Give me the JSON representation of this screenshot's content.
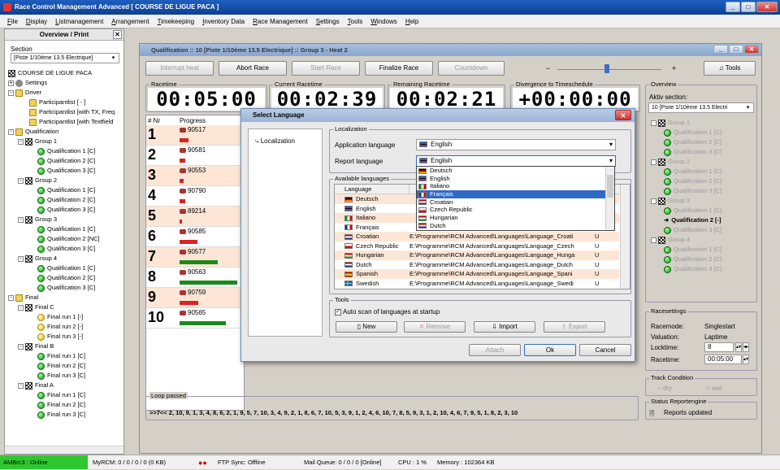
{
  "app": {
    "title": "Race Control Management Advanced  [ COURSE DE LIGUE PACA ]"
  },
  "menu": [
    "File",
    "Display",
    "Listmanagement",
    "Arrangement",
    "Timekeeping",
    "Inventory Data",
    "Race Management",
    "Settings",
    "Tools",
    "Windows",
    "Help"
  ],
  "left": {
    "title": "Overview / Print",
    "section_label": "Section",
    "section_value": "[Piste 1/10ème 13.5 Electrique]",
    "tree": [
      "COURSE DE LIGUE PACA",
      "Settings",
      "Driver",
      "Participantlist  [ - ]",
      "Participantlist [with TX, Freq",
      "Participantlist [with Textfield",
      "Qualification",
      "Group 1",
      "Qualification 1  [C]",
      "Qualification 2  [C]",
      "Qualification 3  [C]",
      "Group 2",
      "Qualification 1  [C]",
      "Qualification 2  [C]",
      "Qualification 3  [C]",
      "Group 3",
      "Qualification 1  [C]",
      "Qualification 2  [NC]",
      "Qualification 3  [C]",
      "Group 4",
      "Qualification 1  [C]",
      "Qualification 2  [C]",
      "Qualification 3  [C]",
      "Final",
      "Final C",
      "Final run 1  [-]",
      "Final run 2  [-]",
      "Final run 3  [-]",
      "Final B",
      "Final run 1  [C]",
      "Final run 2  [C]",
      "Final run 3  [C]",
      "Final A",
      "Final run 1  [C]",
      "Final run 2  [C]",
      "Final run 3  [C]"
    ]
  },
  "main": {
    "title": "Qualification :: 10  [Piste 1/10ème 13.5 Electrique] :: Group 3 - Heat 2",
    "buttons": {
      "interrupt": "Interrupt heat",
      "abort": "Abort Race",
      "start": "Start Race",
      "finalize": "Finalize Race",
      "countdown": "Countdown",
      "tools": "Tools"
    },
    "timers": {
      "racetime_label": "Racetime",
      "racetime": "00:05:00",
      "current_label": "Current Racetime",
      "current": "00:02:39",
      "remaining_label": "Remaining Racetime",
      "remaining": "00:02:21",
      "divergence_label": "Divergence to Timeschedule",
      "divergence": "+00:00:00"
    },
    "table": {
      "col_nr": "# Nr",
      "col_progress": "Progress",
      "rows": [
        {
          "n": "1",
          "id": "90517",
          "progress": 0.14,
          "color": "red"
        },
        {
          "n": "2",
          "id": "90581",
          "progress": 0.09,
          "color": "red"
        },
        {
          "n": "3",
          "id": "90553",
          "progress": 0.07,
          "color": "red"
        },
        {
          "n": "4",
          "id": "90790",
          "progress": 0.09,
          "color": "red"
        },
        {
          "n": "5",
          "id": "89214",
          "progress": 0.04,
          "color": "red"
        },
        {
          "n": "6",
          "id": "90585",
          "progress": 0.29,
          "color": "red"
        },
        {
          "n": "7",
          "id": "90577",
          "progress": 0.63,
          "color": "green"
        },
        {
          "n": "8",
          "id": "90563",
          "progress": 0.94,
          "color": "green"
        },
        {
          "n": "9",
          "id": "90759",
          "progress": 0.31,
          "color": "red"
        },
        {
          "n": "10",
          "id": "90565",
          "progress": 0.76,
          "color": "green"
        }
      ]
    },
    "loop": {
      "label": "Loop passed",
      "text": ">>7<< 2, 10, 9, 1, 3, 4, 8, 6, 2, 1, 9, 5, 7, 10, 3, 4, 9, 2, 1, 8, 6, 7, 10, 5, 3, 9, 1, 2, 4, 6, 10, 7, 8, 5, 9, 3, 1, 2, 10, 4, 6, 7, 9, 5, 1, 8, 2, 3, 10"
    }
  },
  "overview": {
    "title": "Overview",
    "aktiv_label": "Aktiv section:",
    "aktiv_value": "10  [Piste 1/10ème 13.5 Electri",
    "tree": [
      "Group 1",
      "Qualification 1  [C]",
      "Qualification 2  [C]",
      "Qualification 3  [C]",
      "Group 2",
      "Qualification 1  [C]",
      "Qualification 2  [C]",
      "Qualification 3  [C]",
      "Group 3",
      "Qualification 1  [C]",
      "Qualification 2  [-]",
      "Qualification 3  [C]",
      "Group 4",
      "Qualification 1  [C]",
      "Qualification 2  [C]",
      "Qualification 3  [C]"
    ]
  },
  "racesettings": {
    "title": "Racesettings",
    "racemode_label": "Racemode:",
    "racemode": "Singlestart",
    "valuation_label": "Valuation:",
    "valuation": "Laptime",
    "locktime_label": "Locktime:",
    "locktime": "8",
    "racetime_label": "Racetime:",
    "racetime": "00:05:00"
  },
  "track": {
    "title": "Track Condition",
    "dry": "dry",
    "wet": "wet"
  },
  "reportengine": {
    "title": "Status Reportengine",
    "status": "Reports updated"
  },
  "dialog": {
    "title": "Select Language",
    "nav": "Localization",
    "localization_group": "Localization",
    "app_lang_label": "Application language",
    "app_lang": "English",
    "report_lang_label": "Report language",
    "report_lang": "English",
    "dropdown": [
      "Deutsch",
      "English",
      "Italiano",
      "Français",
      "Croatian",
      "Czech Republic",
      "Hungarian",
      "Dutch"
    ],
    "available_label": "Available languages",
    "lv_col1": "Language",
    "languages": [
      {
        "name": "Deutsch",
        "path": "",
        "u": ""
      },
      {
        "name": "English",
        "path": "",
        "u": ""
      },
      {
        "name": "Italiano",
        "path": "",
        "u": ""
      },
      {
        "name": "Français",
        "path": "",
        "u": ""
      },
      {
        "name": "Croatian",
        "path": "E:\\Programme\\RCM Advanced\\Languages\\Language_Croati",
        "u": "U"
      },
      {
        "name": "Czech Republic",
        "path": "E:\\Programme\\RCM Advanced\\Languages\\Language_Czech",
        "u": "U"
      },
      {
        "name": "Hungarian",
        "path": "E:\\Programme\\RCM Advanced\\Languages\\Language_Hunga",
        "u": "U"
      },
      {
        "name": "Dutch",
        "path": "E:\\Programme\\RCM Advanced\\Languages\\Language_Dutch",
        "u": "U"
      },
      {
        "name": "Spanish",
        "path": "E:\\Programme\\RCM Advanced\\Languages\\Language_Spani",
        "u": "U"
      },
      {
        "name": "Swedish",
        "path": "E:\\Programme\\RCM Advanced\\Languages\\Language_Swedi",
        "u": "U"
      }
    ],
    "tools_label": "Tools",
    "autoscan": "Auto scan of languages at startup",
    "new": "New",
    "remove": "Remove",
    "import": "Import",
    "export": "Export",
    "attach": "Attach",
    "ok": "Ok",
    "cancel": "Cancel"
  },
  "status": {
    "ambrc": "AMBrc3 : Online",
    "myrcm": "MyRCM: 0 / 0 / 0 / 0 (0 KB)",
    "ftp": "FTP Sync: Offline",
    "mail": "Mail Queue: 0 / 0 / 0 [Online]",
    "cpu": "CPU : 1 %",
    "memory": "Memory : 102364 KB"
  }
}
